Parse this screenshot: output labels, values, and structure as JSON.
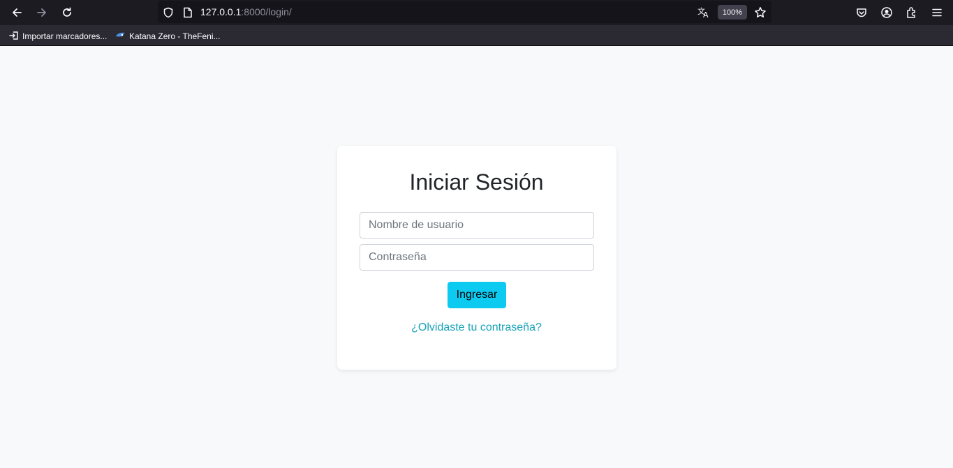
{
  "browser": {
    "url_host": "127.0.0.1",
    "url_rest": ":8000/login/",
    "zoom": "100%",
    "bookmarks": [
      {
        "label": "Importar marcadores...",
        "icon": "import-icon"
      },
      {
        "label": "Katana Zero - TheFeni...",
        "icon": "site-favicon"
      }
    ]
  },
  "login": {
    "title": "Iniciar Sesión",
    "username_placeholder": "Nombre de usuario",
    "username_value": "",
    "password_placeholder": "Contraseña",
    "password_value": "",
    "submit_label": "Ingresar",
    "forgot_link": "¿Olvidaste tu contraseña?"
  },
  "colors": {
    "page_bg": "#f8f9fa",
    "button": "#0dcaf0",
    "link": "#17a2b8",
    "chrome_dark": "#1c1b22"
  }
}
